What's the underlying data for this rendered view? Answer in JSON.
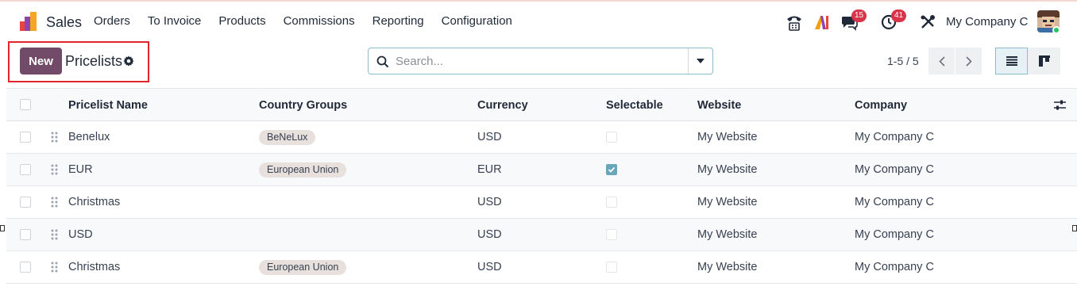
{
  "navbar": {
    "app_name": "Sales",
    "menu": [
      "Orders",
      "To Invoice",
      "Products",
      "Commissions",
      "Reporting",
      "Configuration"
    ],
    "messages_badge": "15",
    "activities_badge": "41",
    "company": "My Company C"
  },
  "control": {
    "new_label": "New",
    "breadcrumb": "Pricelists",
    "search_placeholder": "Search...",
    "pager": "1-5 / 5"
  },
  "table": {
    "columns": [
      "Pricelist Name",
      "Country Groups",
      "Currency",
      "Selectable",
      "Website",
      "Company"
    ],
    "rows": [
      {
        "name": "Benelux",
        "country_group": "BeNeLux",
        "currency": "USD",
        "selectable": false,
        "website": "My Website",
        "company": "My Company C"
      },
      {
        "name": "EUR",
        "country_group": "European Union",
        "currency": "EUR",
        "selectable": true,
        "website": "My Website",
        "company": "My Company C"
      },
      {
        "name": "Christmas",
        "country_group": "",
        "currency": "USD",
        "selectable": false,
        "website": "My Website",
        "company": "My Company C"
      },
      {
        "name": "USD",
        "country_group": "",
        "currency": "USD",
        "selectable": false,
        "website": "My Website",
        "company": "My Company C"
      },
      {
        "name": "Christmas",
        "country_group": "European Union",
        "currency": "USD",
        "selectable": false,
        "website": "My Website",
        "company": "My Company C"
      }
    ]
  },
  "colors": {
    "primary": "#714b67",
    "highlight_border": "#e0262b",
    "badge": "#d9354a",
    "checkbox_checked": "#6aa6b9"
  },
  "icons": [
    "phone-icon",
    "ai-icon",
    "messages-icon",
    "activity-clock-icon",
    "debug-tools-icon",
    "gear-icon",
    "search-icon",
    "caret-down-icon",
    "chevron-left-icon",
    "chevron-right-icon",
    "list-view-icon",
    "kanban-view-icon",
    "optional-columns-icon",
    "drag-handle-icon"
  ]
}
